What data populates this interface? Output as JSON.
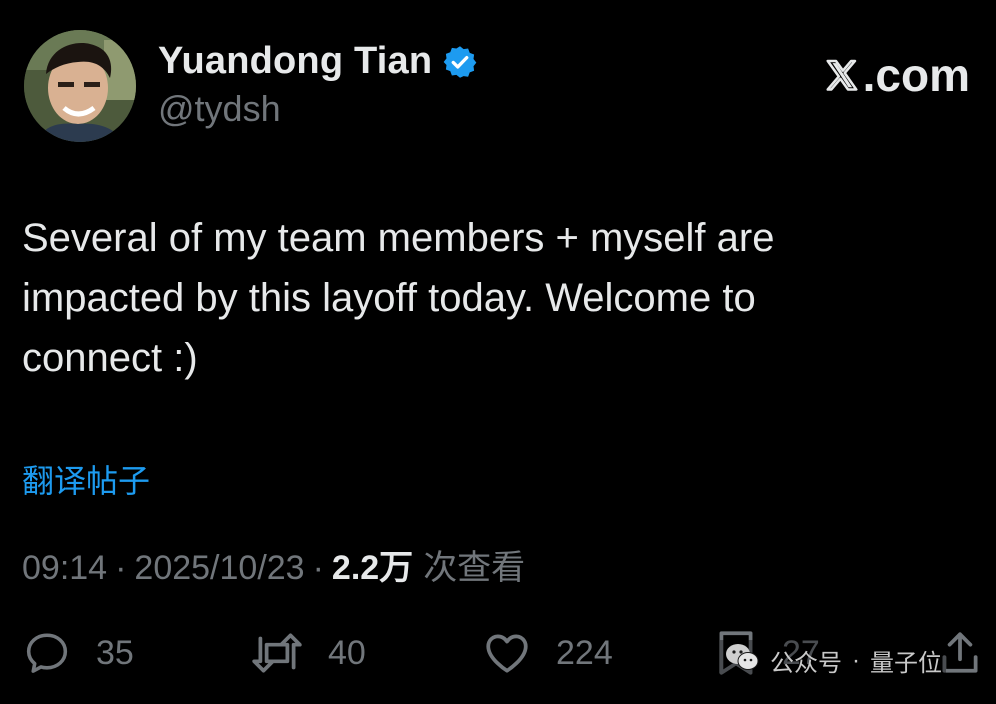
{
  "author": {
    "display_name": "Yuandong Tian",
    "handle": "@tydsh",
    "verified": true
  },
  "site": {
    "logo_suffix": ".com"
  },
  "tweet": {
    "text": "Several of my team members + myself are\nimpacted by this layoff today. Welcome to\nconnect :)",
    "translate_label": "翻译帖子"
  },
  "meta": {
    "time": "09:14",
    "date": "2025/10/23",
    "separator": "·",
    "views_count": "2.2万",
    "views_label": "次查看"
  },
  "actions": {
    "replies": "35",
    "reposts": "40",
    "likes": "224",
    "bookmarks": "27"
  },
  "watermark": {
    "source": "公众号",
    "separator": "·",
    "name": "量子位"
  },
  "colors": {
    "background": "#000000",
    "primary_text": "#e7e9ea",
    "secondary_text": "#71767b",
    "link": "#1d9bf0",
    "verified_badge": "#1d9bf0"
  }
}
